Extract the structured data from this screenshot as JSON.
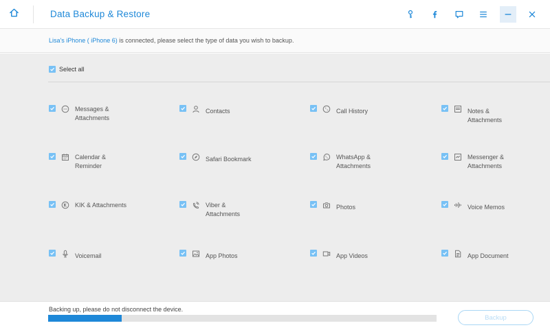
{
  "header": {
    "title": "Data Backup & Restore",
    "icons": [
      "home-icon",
      "key-icon",
      "facebook-icon",
      "feedback-icon",
      "menu-icon",
      "minimize-icon",
      "close-icon"
    ],
    "accent_color": "#1e88d8"
  },
  "status": {
    "device_name": "Lisa's iPhone ( iPhone 6)",
    "message": " is connected, please select the type of data you wish to backup."
  },
  "select_all": {
    "label": "Select all",
    "checked": true
  },
  "data_types": [
    {
      "label": "Messages & Attachments",
      "icon": "message-icon",
      "checked": true
    },
    {
      "label": "Contacts",
      "icon": "contact-icon",
      "checked": true
    },
    {
      "label": "Call History",
      "icon": "phone-icon",
      "checked": true
    },
    {
      "label": "Notes & Attachments",
      "icon": "note-icon",
      "checked": true
    },
    {
      "label": "Calendar & Reminder",
      "icon": "calendar-icon",
      "checked": true
    },
    {
      "label": "Safari Bookmark",
      "icon": "compass-icon",
      "checked": true
    },
    {
      "label": "WhatsApp & Attachments",
      "icon": "whatsapp-icon",
      "checked": true
    },
    {
      "label": "Messenger & Attachments",
      "icon": "messenger-icon",
      "checked": true
    },
    {
      "label": "KIK & Attachments",
      "icon": "kik-icon",
      "checked": true
    },
    {
      "label": "Viber & Attachments",
      "icon": "viber-icon",
      "checked": true
    },
    {
      "label": "Photos",
      "icon": "camera-icon",
      "checked": true
    },
    {
      "label": "Voice Memos",
      "icon": "waveform-icon",
      "checked": true
    },
    {
      "label": "Voicemail",
      "icon": "microphone-icon",
      "checked": true
    },
    {
      "label": "App Photos",
      "icon": "image-icon",
      "checked": true
    },
    {
      "label": "App Videos",
      "icon": "video-icon",
      "checked": true
    },
    {
      "label": "App Document",
      "icon": "document-icon",
      "checked": true
    }
  ],
  "footer": {
    "message": "Backing up, please do not disconnect the device.",
    "progress": 0.19,
    "backup_label": "Backup"
  }
}
